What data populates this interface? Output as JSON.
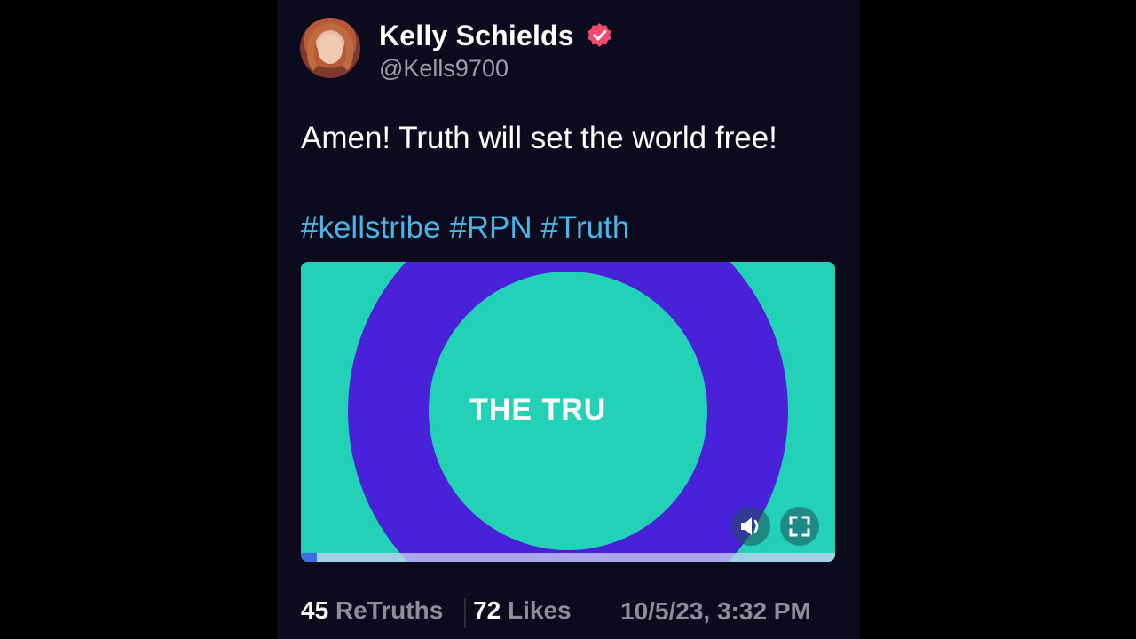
{
  "post": {
    "author_name": "Kelly Schields",
    "author_handle": "@Kells9700",
    "text": "Amen! Truth will set the world free!",
    "hashtags": [
      "#kellstribe",
      "#RPN",
      "#Truth"
    ],
    "verified_icon": "verified-badge-icon",
    "colors": {
      "verified": "#f34b6e",
      "hashtag": "#4bb4e6",
      "background": "#0c0a1d"
    }
  },
  "media": {
    "title_text": "THE TRU",
    "sound_icon": "speaker-icon",
    "fullscreen_icon": "fullscreen-icon",
    "progress_fraction": 0.03,
    "colors": {
      "teal": "#22d1b6",
      "purple": "#4821d8"
    }
  },
  "stats": {
    "retruths_count": "45",
    "retruths_label": "ReTruths",
    "likes_count": "72",
    "likes_label": "Likes",
    "timestamp": "10/5/23, 3:32 PM"
  }
}
